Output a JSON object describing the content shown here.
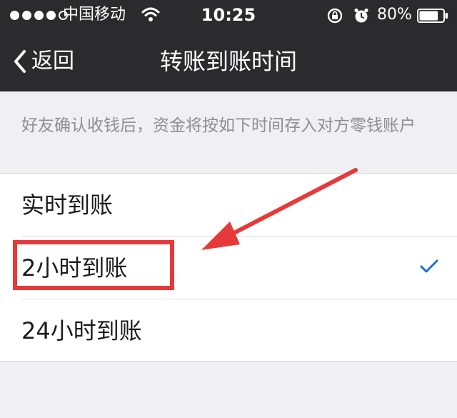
{
  "status_bar": {
    "carrier": "中国移动",
    "time": "10:25",
    "battery_percent": "80%",
    "battery_level": 0.8,
    "signal_bars_filled": 4,
    "signal_bars_total": 5,
    "icons": [
      "wifi-icon",
      "orientation-lock-icon",
      "alarm-icon",
      "battery-icon"
    ]
  },
  "nav": {
    "back_label": "返回",
    "title": "转账到账时间"
  },
  "description": "好友确认收钱后，资金将按如下时间存入对方零钱账户",
  "options": [
    {
      "label": "实时到账",
      "selected": false
    },
    {
      "label": "2小时到账",
      "selected": true
    },
    {
      "label": "24小时到账",
      "selected": false
    }
  ],
  "colors": {
    "header_bg": "#2b2b2d",
    "page_bg": "#efeff4",
    "list_bg": "#ffffff",
    "check": "#1a6fd9",
    "annotation_red": "#e63a3a",
    "description_text": "#8e8e93"
  },
  "annotation": {
    "highlight_box": "red",
    "arrow": "red",
    "target_option_index": 1
  }
}
